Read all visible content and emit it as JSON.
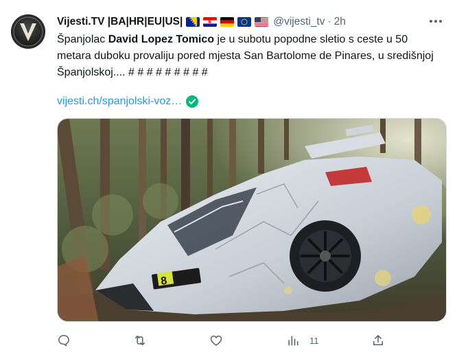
{
  "author": {
    "display_name": "Vijesti.TV |BA|HR|EU|US|",
    "handle": "@vijesti_tv",
    "separator": "·",
    "time": "2h",
    "avatar_letter": "V",
    "flags": [
      "flag-bosnia-icon",
      "flag-croatia-icon",
      "flag-germany-icon",
      "flag-eu-icon",
      "flag-usa-icon"
    ]
  },
  "tweet": {
    "text_before": "Španjolac ",
    "text_bold": "David Lopez Tomico",
    "text_after": " je u subotu popodne sletio s ceste u 50 metara duboku provaliju pored mjesta San Bartolome de Pinares, u središnjoj Španjolskoj.... # # # # # # # # #",
    "link_text": "vijesti.ch/spanjolski-voz…"
  },
  "media": {
    "car_number": "8",
    "colors": {
      "accent_link": "#1d9bf0",
      "muted": "#536471",
      "verified": "#00ba7c"
    }
  },
  "actions": {
    "views_count": "11"
  }
}
